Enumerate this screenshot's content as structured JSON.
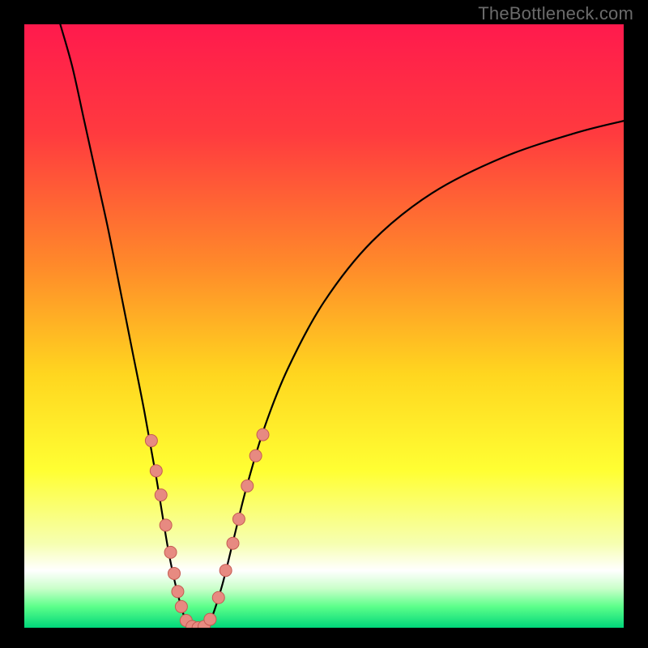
{
  "watermark": "TheBottleneck.com",
  "colors": {
    "background": "#000000",
    "curve": "#000000",
    "dot_fill": "#e78a81",
    "dot_stroke": "#c55b52"
  },
  "chart_data": {
    "type": "line",
    "title": "",
    "xlabel": "",
    "ylabel": "",
    "xlim": [
      0,
      100
    ],
    "ylim": [
      0,
      100
    ],
    "note": "V-shaped bottleneck curve; y approximates percentage bottleneck, x is a normalized component-ratio axis. Values estimated from pixel positions (no tick labels present).",
    "gradient_stops": [
      {
        "pos": 0.0,
        "color": "#ff1a4d"
      },
      {
        "pos": 0.18,
        "color": "#ff3a3f"
      },
      {
        "pos": 0.4,
        "color": "#ff8a2a"
      },
      {
        "pos": 0.58,
        "color": "#ffd61f"
      },
      {
        "pos": 0.74,
        "color": "#ffff33"
      },
      {
        "pos": 0.86,
        "color": "#f6ffb0"
      },
      {
        "pos": 0.905,
        "color": "#ffffff"
      },
      {
        "pos": 0.935,
        "color": "#caffca"
      },
      {
        "pos": 0.965,
        "color": "#5cff8a"
      },
      {
        "pos": 1.0,
        "color": "#00d67a"
      }
    ],
    "series": [
      {
        "name": "bottleneck-curve",
        "x": [
          6.0,
          8.0,
          10.0,
          12.0,
          14.0,
          16.0,
          18.0,
          20.0,
          22.0,
          24.0,
          25.5,
          27.0,
          28.0,
          29.0,
          30.0,
          31.0,
          33.0,
          35.0,
          37.0,
          40.0,
          44.0,
          50.0,
          58.0,
          68.0,
          80.0,
          92.0,
          100.0
        ],
        "y": [
          100.0,
          93.0,
          84.0,
          75.0,
          66.0,
          56.0,
          46.0,
          36.0,
          25.0,
          13.0,
          6.0,
          1.0,
          0.0,
          0.0,
          0.0,
          1.0,
          7.0,
          15.0,
          23.0,
          33.0,
          43.0,
          54.0,
          64.0,
          72.0,
          78.0,
          82.0,
          84.0
        ]
      }
    ],
    "dots": {
      "name": "sample-points",
      "points": [
        {
          "x": 21.2,
          "y": 31.0
        },
        {
          "x": 22.0,
          "y": 26.0
        },
        {
          "x": 22.8,
          "y": 22.0
        },
        {
          "x": 23.6,
          "y": 17.0
        },
        {
          "x": 24.4,
          "y": 12.5
        },
        {
          "x": 25.0,
          "y": 9.0
        },
        {
          "x": 25.6,
          "y": 6.0
        },
        {
          "x": 26.2,
          "y": 3.5
        },
        {
          "x": 27.0,
          "y": 1.2
        },
        {
          "x": 28.0,
          "y": 0.2
        },
        {
          "x": 29.0,
          "y": 0.0
        },
        {
          "x": 30.0,
          "y": 0.2
        },
        {
          "x": 31.0,
          "y": 1.4
        },
        {
          "x": 32.4,
          "y": 5.0
        },
        {
          "x": 33.6,
          "y": 9.5
        },
        {
          "x": 34.8,
          "y": 14.0
        },
        {
          "x": 35.8,
          "y": 18.0
        },
        {
          "x": 37.2,
          "y": 23.5
        },
        {
          "x": 38.6,
          "y": 28.5
        },
        {
          "x": 39.8,
          "y": 32.0
        }
      ]
    }
  }
}
